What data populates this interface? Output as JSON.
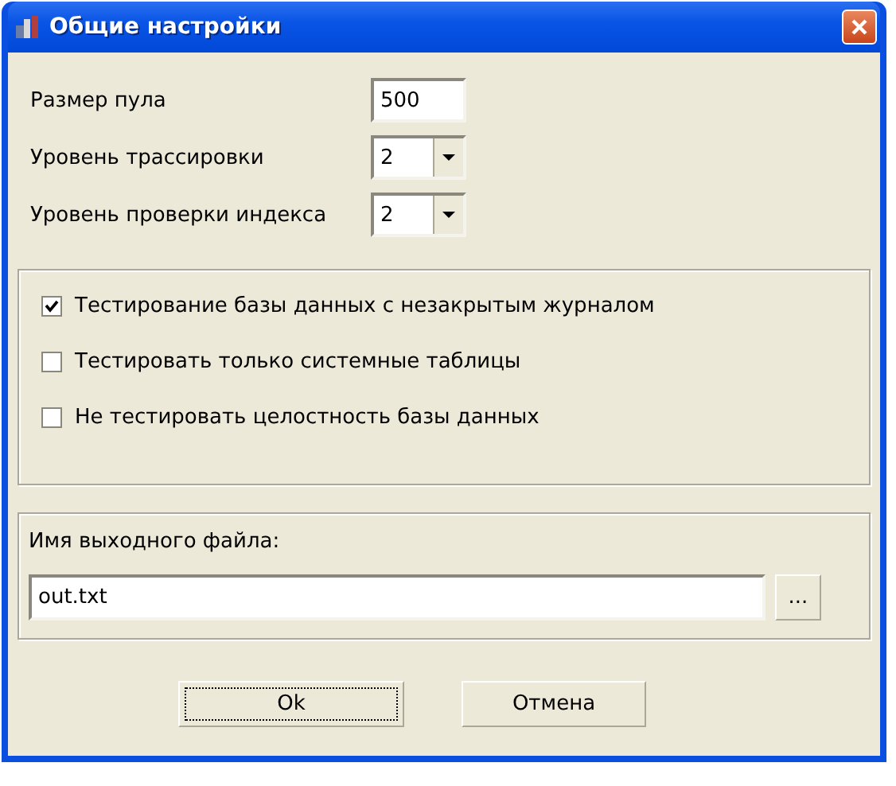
{
  "window": {
    "title": "Общие настройки"
  },
  "fields": [
    {
      "kind": "text",
      "label": "Размер пула",
      "value": "500"
    },
    {
      "kind": "dropdown",
      "label": "Уровень трассировки",
      "value": "2"
    },
    {
      "kind": "dropdown",
      "label": "Уровень проверки индекса",
      "value": "2"
    }
  ],
  "options": [
    {
      "label": "Тестирование базы данных с незакрытым журналом",
      "checked": true
    },
    {
      "label": "Тестировать только системные таблицы",
      "checked": false
    },
    {
      "label": "Не тестировать целостность базы данных",
      "checked": false
    }
  ],
  "output_file": {
    "label": "Имя выходного файла:",
    "value": "out.txt",
    "browse": "..."
  },
  "buttons": [
    {
      "label": "Ok",
      "focused": true
    },
    {
      "label": "Отмена",
      "focused": false
    }
  ]
}
